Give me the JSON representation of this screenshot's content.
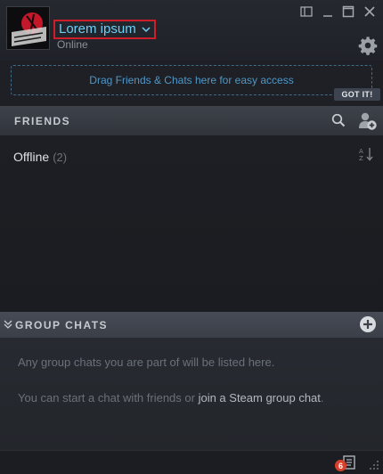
{
  "header": {
    "username": "Lorem ipsum",
    "status": "Online",
    "avatar_icon": "avatar-logo-image",
    "window_controls": [
      "restore-layout-icon",
      "minimize-icon",
      "maximize-icon",
      "close-icon"
    ],
    "settings_icon": "gear-icon"
  },
  "dropzone": {
    "text": "Drag Friends & Chats here for easy access",
    "got_it": "GOT IT!"
  },
  "friends": {
    "title": "FRIENDS",
    "search_icon": "search-icon",
    "add_friend_icon": "add-friend-icon",
    "offline_label": "Offline",
    "offline_count": "(2)",
    "sort_icon": "sort-icon"
  },
  "group_chats": {
    "title": "GROUP CHATS",
    "empty_text": "Any group chats you are part of will be listed here.",
    "hint_prefix": "You can start a chat with friends or ",
    "hint_link": "join a Steam group chat",
    "hint_suffix": "."
  },
  "footer": {
    "notification_count": "6",
    "notification_icon": "notifications-icon",
    "resize_icon": "resize-grip-icon"
  },
  "colors": {
    "accent": "#6dcff6",
    "highlight_border": "#cc1f2b",
    "link": "#4f97c6",
    "badge": "#d9402b"
  }
}
